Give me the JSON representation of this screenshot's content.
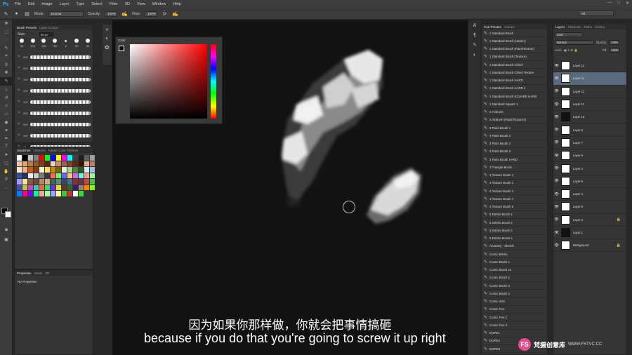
{
  "app": {
    "logo": "Ps",
    "window_controls": [
      "—",
      "□",
      "✕"
    ]
  },
  "menu": [
    "File",
    "Edit",
    "Image",
    "Layer",
    "Type",
    "Select",
    "Filter",
    "3D",
    "View",
    "Window",
    "Help"
  ],
  "options": {
    "mode_label": "Mode:",
    "mode_value": "Normal",
    "opacity_label": "Opacity:",
    "opacity_value": "100%",
    "flow_label": "Flow:",
    "flow_value": "100%",
    "workspace": "All"
  },
  "brush_presets": {
    "tabs": [
      "Brush Presets",
      "Layer Comps"
    ],
    "size_label": "Size:",
    "size_value": "80 px",
    "tips": [
      "30",
      "100",
      "125",
      "100",
      "8",
      "90",
      "45"
    ],
    "strokes": [
      "500",
      "500",
      "150",
      "100",
      "100",
      "500",
      "500",
      "100",
      "50",
      "500"
    ]
  },
  "swatches": {
    "tabs": [
      "Swatches",
      "Libraries",
      "Adobe Color Themes"
    ],
    "colors": [
      "#ffffff",
      "#000000",
      "#c0c0c0",
      "#808080",
      "#ff0000",
      "#00ff00",
      "#0000ff",
      "#ffff00",
      "#ff00ff",
      "#00ffff",
      "#404040",
      "#202020",
      "#606060",
      "#a0a0a0",
      "#e8c8a8",
      "#d8a878",
      "#b87848",
      "#985828",
      "#784018",
      "#582808",
      "#f0d0c0",
      "#c89078",
      "#a06048",
      "#804030",
      "#602818",
      "#401008",
      "#e0b090",
      "#c08060",
      "#fce4d6",
      "#f4b084",
      "#c65911",
      "#843c0c",
      "#fff2cc",
      "#ffd966",
      "#bf8f00",
      "#7f6000",
      "#e2efda",
      "#a9d08e",
      "#548235",
      "#375623",
      "#ddebf7",
      "#9bc2e6",
      "#2f5597",
      "#1f3864",
      "#ededed",
      "#c9c9c9",
      "#7b7b7b",
      "#3a3a3a",
      "#ff6666",
      "#66ff66",
      "#6666ff",
      "#ffcc66",
      "#cc66ff",
      "#66ffcc",
      "#ff9999",
      "#99ff99",
      "#9999ff",
      "#ffe0a0",
      "#8a5a44",
      "#6e4a3a",
      "#b8866b",
      "#d9a88a",
      "#3d6b4f",
      "#5c8a6e",
      "#2e4a6b",
      "#4a6e8a",
      "#8a2e2e",
      "#6b2e4a",
      "#c04848",
      "#48c048",
      "#4848c0",
      "#c0c048",
      "#c048c0",
      "#48c0c0",
      "#e07030",
      "#30e070",
      "#7030e0",
      "#e0e030",
      "#703020",
      "#207030",
      "#302070",
      "#a08060",
      "#ff8000",
      "#80ff00",
      "#0080ff",
      "#ff0080",
      "#8000ff",
      "#00ff80",
      "#ffa0a0",
      "#a0ffa0",
      "#a0a0ff",
      "#ffffa0",
      "#33cc33",
      "#cc3333"
    ],
    "tail": [
      "#ffffff",
      "#33dd33"
    ]
  },
  "properties": {
    "tabs": [
      "Properties",
      "Notes",
      "3D"
    ],
    "empty_text": "No Properties"
  },
  "color_panel": {
    "title": "Color"
  },
  "tool_presets": {
    "tabs": [
      "Tool Presets",
      "Actions"
    ],
    "items": [
      "1 Standard Brush",
      "1 Standard Brush (Harder)",
      "1 Standard Brush (Paint/Texture)",
      "1 Standard Brush (Texture)",
      "1 Standard Brush Chisel",
      "1 Standard Brush Chisel Texture",
      "1 Standard Brush HARD",
      "1 Standard Brush HARD 2",
      "1 Standard Brush SQUARE HARD",
      "1 Standard Square 1",
      "2 Airbrush",
      "2 Airbrush (Paint/Texture1)",
      "3 Paint Brush 1",
      "3 Paint Brush 2",
      "3 Paint Brush 4",
      "3 Paint Brush 3",
      "3 Paint Brush HARD",
      "3 Triangle Brush",
      "4 Texture Brush 1",
      "4 Texture Brush 2",
      "4 Texture Brush 3",
      "4 Texture Brush 4",
      "4 Texture Brush 5",
      "5 Debris Brush 1",
      "5 Debris Brush 2",
      "5 Debris Brush 3",
      "5 Debris Brush 4",
      "Anatomy - Sketch",
      "Comic Bricks",
      "Comic Brush 1",
      "Comic Brush 1a",
      "Comic Brush 2",
      "Comic Brush 3",
      "Comic Brush 4",
      "Comic dots",
      "Comic Pen",
      "Comic Pen 2",
      "Comic Pen 3",
      "DOPE1",
      "DOPE2",
      "DOPE3"
    ]
  },
  "layers": {
    "tabs": [
      "Layers",
      "Channels",
      "Paths",
      "History"
    ],
    "kind_label": "Kind",
    "blend_mode": "Normal",
    "opacity_label": "Opacity:",
    "opacity_value": "100%",
    "lock_label": "Lock:",
    "fill_label": "Fill:",
    "fill_value": "100%",
    "items": [
      {
        "name": "Layer 12",
        "selected": false,
        "dark": false,
        "lock": false
      },
      {
        "name": "Layer 14",
        "selected": true,
        "dark": false,
        "lock": false
      },
      {
        "name": "Layer 13",
        "selected": false,
        "dark": false,
        "lock": false
      },
      {
        "name": "Layer 11",
        "selected": false,
        "dark": false,
        "lock": false
      },
      {
        "name": "Layer 10",
        "selected": false,
        "dark": true,
        "lock": false
      },
      {
        "name": "Layer 8",
        "selected": false,
        "dark": false,
        "lock": false
      },
      {
        "name": "Layer 7",
        "selected": false,
        "dark": false,
        "lock": false
      },
      {
        "name": "Layer 6",
        "selected": false,
        "dark": false,
        "lock": false
      },
      {
        "name": "Layer 3",
        "selected": false,
        "dark": false,
        "lock": false
      },
      {
        "name": "Layer 5",
        "selected": false,
        "dark": false,
        "lock": false
      },
      {
        "name": "Layer 4",
        "selected": false,
        "dark": false,
        "lock": false
      },
      {
        "name": "Layer 9",
        "selected": false,
        "dark": false,
        "lock": false
      },
      {
        "name": "Layer 2",
        "selected": false,
        "dark": false,
        "lock": true
      },
      {
        "name": "Layer 1",
        "selected": false,
        "dark": true,
        "lock": false
      },
      {
        "name": "Background",
        "selected": false,
        "dark": false,
        "lock": true
      }
    ]
  },
  "subtitles": {
    "zh": "因为如果你那样做，你就会把事情搞砸",
    "en": "because if you do that you're going to screw it up right"
  },
  "watermark": {
    "logo": "FS",
    "name": "梵摄创意库",
    "url": "WWW.FSTVC.CC"
  }
}
